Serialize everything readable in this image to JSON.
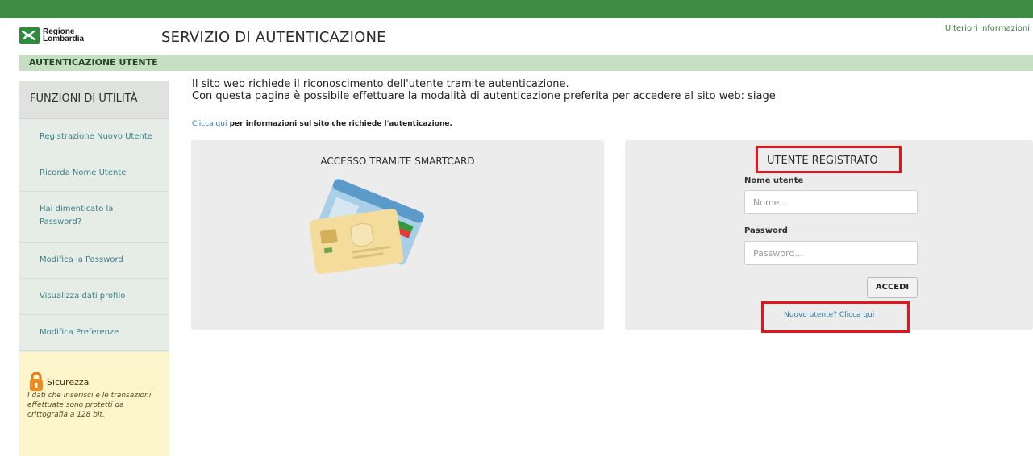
{
  "header": {
    "logo_line1": "Regione",
    "logo_line2": "Lombardia",
    "title": "SERVIZIO DI AUTENTICAZIONE",
    "more_info": "Ulteriori informazioni"
  },
  "section": {
    "title": "AUTENTICAZIONE UTENTE"
  },
  "sidebar": {
    "title": "FUNZIONI DI UTILITÀ",
    "items": [
      {
        "label": "Registrazione Nuovo Utente"
      },
      {
        "label": "Ricorda Nome Utente"
      },
      {
        "label": "Hai dimenticato la Password?"
      },
      {
        "label": "Modifica la Password"
      },
      {
        "label": "Visualizza dati profilo"
      },
      {
        "label": "Modifica Preferenze"
      }
    ],
    "security": {
      "title": "Sicurezza",
      "text": "I dati che inserisci e le transazioni effettuate sono protetti da crittografia a 128 bit."
    }
  },
  "main": {
    "intro_line1": "Il sito web richiede il riconoscimento dell'utente tramite autenticazione.",
    "intro_line2": "Con questa pagina è possibile effettuare la modalità di autenticazione preferita per accedere al sito web: siage",
    "info_link": "Clicca qui",
    "info_text": " per informazioni sul sito che richiede l'autenticazione.",
    "smartcard": {
      "title": "ACCESSO TRAMITE SMARTCARD"
    },
    "registered": {
      "title": "UTENTE REGISTRATO",
      "username_label": "Nome utente",
      "username_placeholder": "Nome...",
      "password_label": "Password",
      "password_placeholder": "Password...",
      "submit_label": "ACCEDI",
      "new_user_link": "Nuovo utente? Clicca qui"
    }
  },
  "colors": {
    "brand_green": "#3f8c45",
    "section_green": "#c6dfc2",
    "highlight_red": "#e0161c",
    "link_blue": "#2a7da0"
  }
}
